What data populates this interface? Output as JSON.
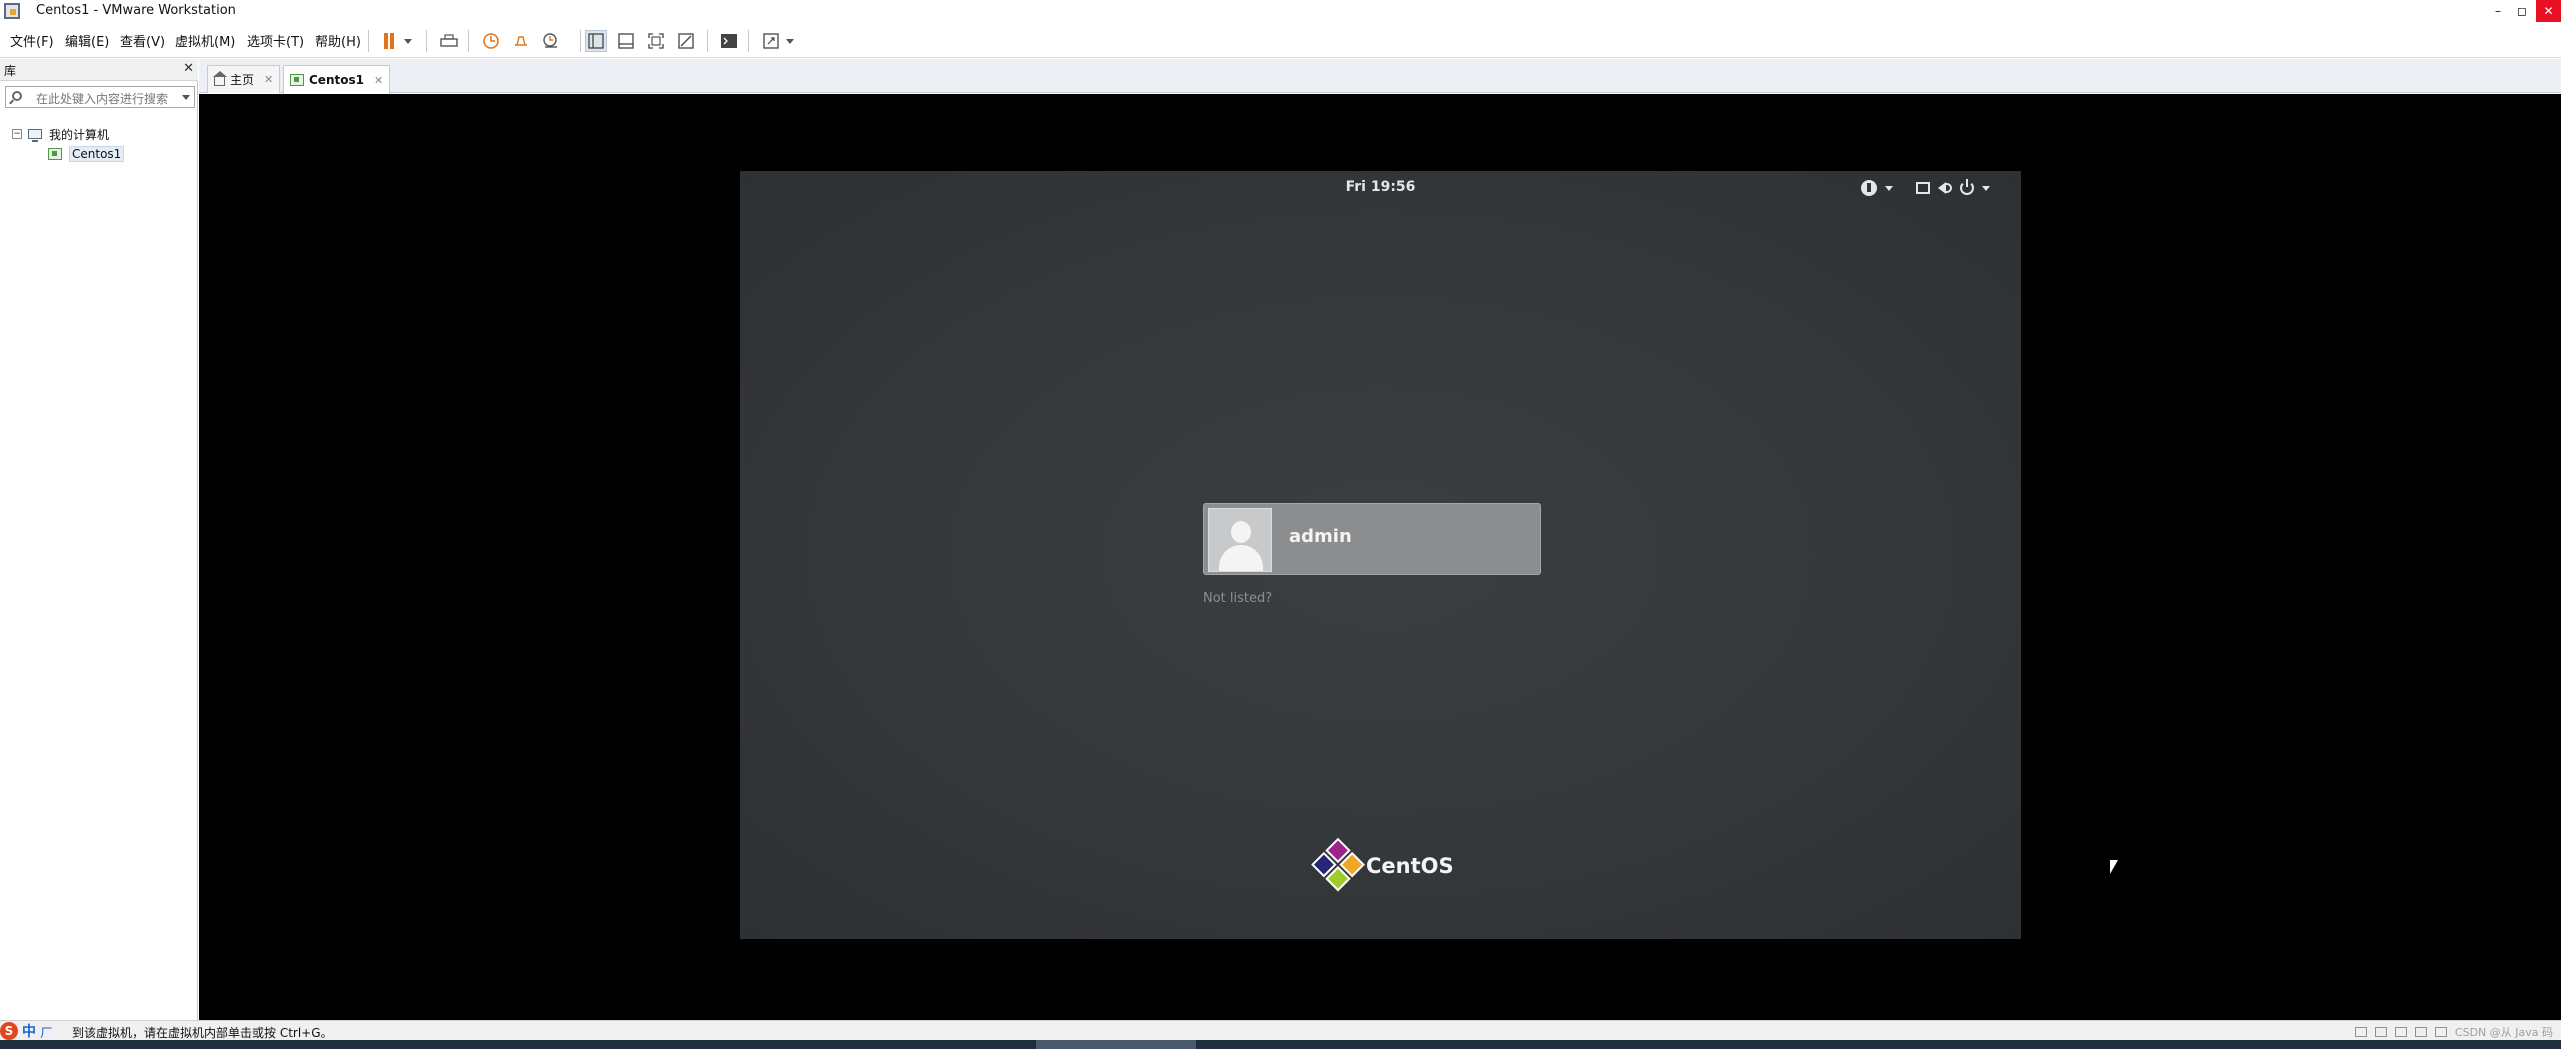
{
  "window": {
    "title": "Centos1 - VMware Workstation",
    "min_glyph": "–",
    "max_glyph": "◻",
    "close_glyph": "✕"
  },
  "menu": {
    "file": "文件(F)",
    "edit": "编辑(E)",
    "view": "查看(V)",
    "vm": "虚拟机(M)",
    "tabs": "选项卡(T)",
    "help": "帮助(H)"
  },
  "library": {
    "title": "库",
    "close_glyph": "✕",
    "search_placeholder": "在此处键入内容进行搜索",
    "tree": {
      "root_toggle": "−",
      "root_label": "我的计算机",
      "vm_label": "Centos1"
    }
  },
  "tabs": [
    {
      "label": "主页",
      "close": "✕"
    },
    {
      "label": "Centos1",
      "close": "✕"
    }
  ],
  "guest": {
    "clock": "Fri 19:56",
    "user_name": "admin",
    "not_listed": "Not listed?",
    "logo_text": "CentOS",
    "logo_colors": [
      "#9c248a",
      "#efa724",
      "#262577",
      "#9ccd2a"
    ]
  },
  "status": {
    "ime_logo": "S",
    "ime_lang": "中",
    "ime_punc": "ㄏ",
    "message": "到该虚拟机，请在虚拟机内部单击或按 Ctrl+G。",
    "tray_text": "CSDN @从 Java 码"
  },
  "colors": {
    "vm_background": "#000000",
    "guest_background": "#34373a",
    "accent_orange": "#e2731a",
    "close_red": "#e81123"
  },
  "icons": {
    "toolbar": [
      "pause-icon",
      "send-keys-icon",
      "snapshot-icon",
      "revert-snapshot-icon",
      "snapshot-manager-icon",
      "library-view-icon",
      "thumbnail-bar-icon",
      "fullscreen-icon",
      "unity-icon",
      "console-icon",
      "stretch-icon"
    ],
    "guest_status": [
      "accessibility-icon",
      "display-icon",
      "volume-icon",
      "power-icon"
    ]
  }
}
